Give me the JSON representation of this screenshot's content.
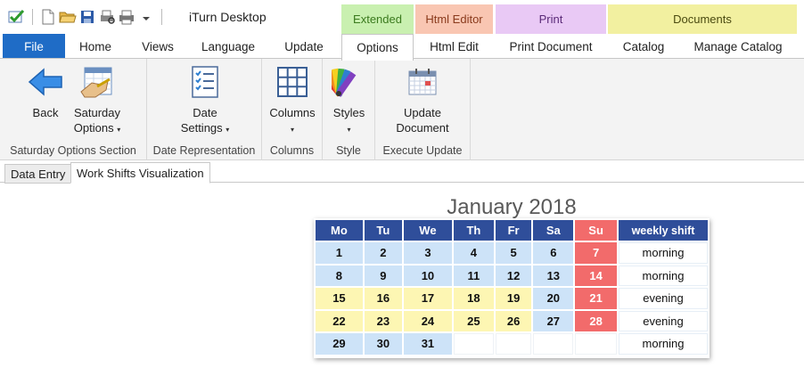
{
  "app": {
    "title": "iTurn Desktop"
  },
  "qat": [
    {
      "name": "check-icon"
    },
    {
      "name": "new-document-icon"
    },
    {
      "name": "open-folder-icon"
    },
    {
      "name": "save-icon"
    },
    {
      "name": "print-preview-icon"
    },
    {
      "name": "printer-icon"
    },
    {
      "name": "dropdown-arrow-icon"
    }
  ],
  "contextual_groups": [
    {
      "label": "Extended",
      "color": "#c9f0b0",
      "text_color": "#3b7a1e"
    },
    {
      "label": "Html Editor",
      "color": "#f9c6b2",
      "text_color": "#8a3a1c"
    },
    {
      "label": "Print",
      "color": "#e9c9f5",
      "text_color": "#5a2a78"
    },
    {
      "label": "Documents",
      "color": "#f2f0a0",
      "text_color": "#4a4a10"
    }
  ],
  "tabs": {
    "file": "File",
    "home": "Home",
    "views": "Views",
    "language": "Language",
    "update": "Update",
    "options": "Options",
    "html_edit": "Html Edit",
    "print_document": "Print Document",
    "catalog": "Catalog",
    "manage_catalog": "Manage Catalog"
  },
  "ribbon": {
    "groups": {
      "saturday": "Saturday Options Section",
      "date_rep": "Date Representation",
      "columns": "Columns",
      "style": "Style",
      "execute": "Execute Update"
    },
    "buttons": {
      "back": "Back",
      "saturday_1": "Saturday",
      "saturday_2": "Options",
      "date_1": "Date",
      "date_2": "Settings",
      "columns": "Columns",
      "styles": "Styles",
      "update_1": "Update",
      "update_2": "Document",
      "caret": "▾"
    }
  },
  "doc_tabs": [
    "Data Entry",
    "Work Shifts Visualization"
  ],
  "calendar": {
    "title": "January 2018",
    "headers": [
      "Mo",
      "Tu",
      "We",
      "Th",
      "Fr",
      "Sa",
      "Su",
      "weekly shift"
    ],
    "weeks": [
      {
        "days": [
          "1",
          "2",
          "3",
          "4",
          "5",
          "6",
          "7"
        ],
        "shift": "morning"
      },
      {
        "days": [
          "8",
          "9",
          "10",
          "11",
          "12",
          "13",
          "14"
        ],
        "shift": "morning"
      },
      {
        "days": [
          "15",
          "16",
          "17",
          "18",
          "19",
          "20",
          "21"
        ],
        "shift": "evening"
      },
      {
        "days": [
          "22",
          "23",
          "24",
          "25",
          "26",
          "27",
          "28"
        ],
        "shift": "evening"
      },
      {
        "days": [
          "29",
          "30",
          "31",
          "",
          "",
          "",
          ""
        ],
        "shift": "morning"
      }
    ],
    "colors": {
      "header": "#2f4e9a",
      "sunday": "#f26b6b",
      "weekday": "#cde3f8",
      "evening_weekday": "#fdf6b3"
    }
  }
}
